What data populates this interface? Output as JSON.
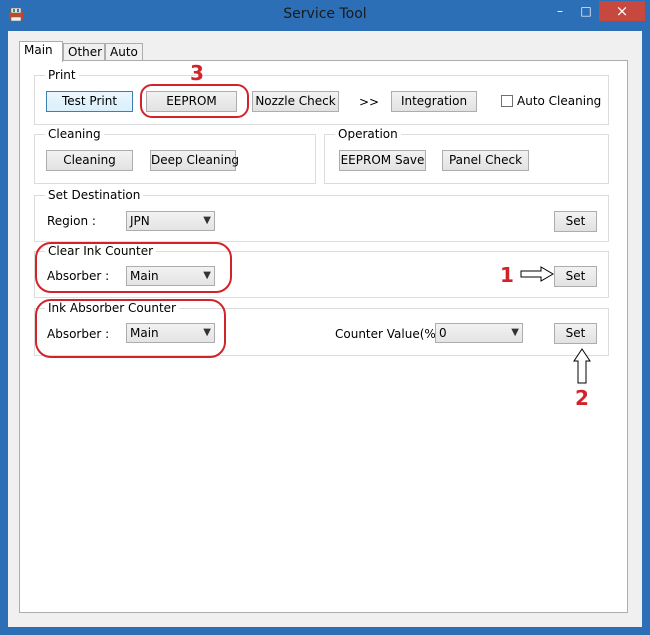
{
  "window": {
    "title": "Service Tool",
    "minimize": "–",
    "maximize": "□",
    "close": "×"
  },
  "tabs": [
    {
      "label": "Main"
    },
    {
      "label": "Other"
    },
    {
      "label": "Auto"
    }
  ],
  "print": {
    "label": "Print",
    "test_print": "Test Print",
    "eeprom": "EEPROM",
    "nozzle_check": "Nozzle Check",
    "arrow": ">>",
    "integration": "Integration",
    "auto_cleaning": "Auto Cleaning"
  },
  "cleaning": {
    "label": "Cleaning",
    "cleaning": "Cleaning",
    "deep_cleaning": "Deep Cleaning"
  },
  "operation": {
    "label": "Operation",
    "eeprom_save": "EEPROM Save",
    "panel_check": "Panel Check"
  },
  "set_destination": {
    "label": "Set Destination",
    "region_label": "Region :",
    "region_value": "JPN",
    "set": "Set"
  },
  "clear_ink_counter": {
    "label": "Clear Ink Counter",
    "absorber_label": "Absorber :",
    "absorber_value": "Main",
    "set": "Set"
  },
  "ink_absorber_counter": {
    "label": "Ink Absorber Counter",
    "absorber_label": "Absorber :",
    "absorber_value": "Main",
    "counter_label": "Counter Value(%) :",
    "counter_value": "0",
    "set": "Set"
  },
  "annotations": {
    "one": "1",
    "two": "2",
    "three": "3",
    "color": "#d2232a"
  }
}
